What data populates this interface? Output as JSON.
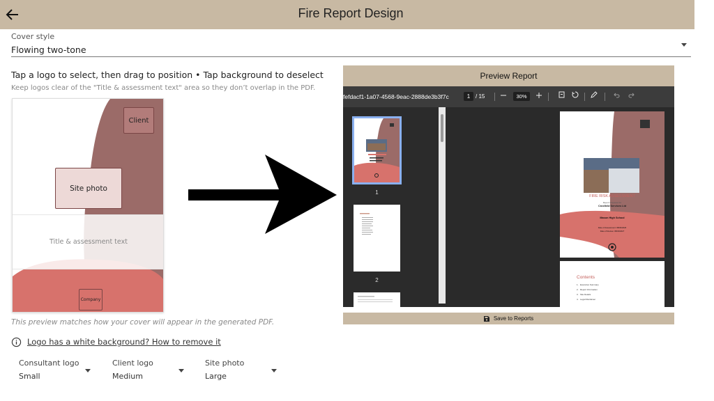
{
  "header": {
    "title": "Fire Report Design"
  },
  "cover_style": {
    "label": "Cover style",
    "value": "Flowing two-tone"
  },
  "instructions": {
    "main": "Tap a logo to select, then drag to position • Tap background to deselect",
    "hint": "Keep logos clear of the \"Title & assessment text\" area so they don’t overlap in the PDF."
  },
  "cover_preview": {
    "client_logo": "Client",
    "site_photo": "Site photo",
    "title_area": "Title & assessment text",
    "company_logo": "Company"
  },
  "preview_note": "This preview matches how your cover will appear in the generated PDF.",
  "help_link": "Logo has a white background? How to remove it",
  "logo_sizes": [
    {
      "label": "Consultant logo",
      "value": "Small"
    },
    {
      "label": "Client logo",
      "value": "Medium"
    },
    {
      "label": "Site photo",
      "value": "Large"
    }
  ],
  "preview_panel": {
    "title": "Preview Report",
    "doc_id": "fefdacf1-1a07-4568-9eac-2888de3b3f7c",
    "current_page": "1",
    "total_pages": "/ 15",
    "zoom": "30%",
    "thumb_labels": [
      "1",
      "2"
    ],
    "page": {
      "report_title": "FIRE RISK ASSESSMENT",
      "prepared_for": "Report Prepared for",
      "company": "Crosfield Services Ltd",
      "school": "Mason High School",
      "assessment_date": "Date of Assessment: 08/03/2026",
      "review_date": "Date of Review: 08/03/2027",
      "contents_title": "Contents",
      "contents_items": [
        "Executive Summary",
        "Report Information",
        "Site Details",
        "Legal Disclaimer"
      ]
    },
    "save_label": "Save to Reports"
  },
  "colors": {
    "header_bg": "#c8b9a3",
    "mauve": "#9b6b68",
    "coral": "#d7726c",
    "viewer_dark": "#2a2a2a"
  },
  "icons": [
    "back-arrow-icon",
    "chevron-down-icon",
    "info-icon",
    "save-icon",
    "minus-icon",
    "plus-icon",
    "rotate-icon",
    "draw-icon",
    "undo-icon",
    "redo-icon"
  ]
}
